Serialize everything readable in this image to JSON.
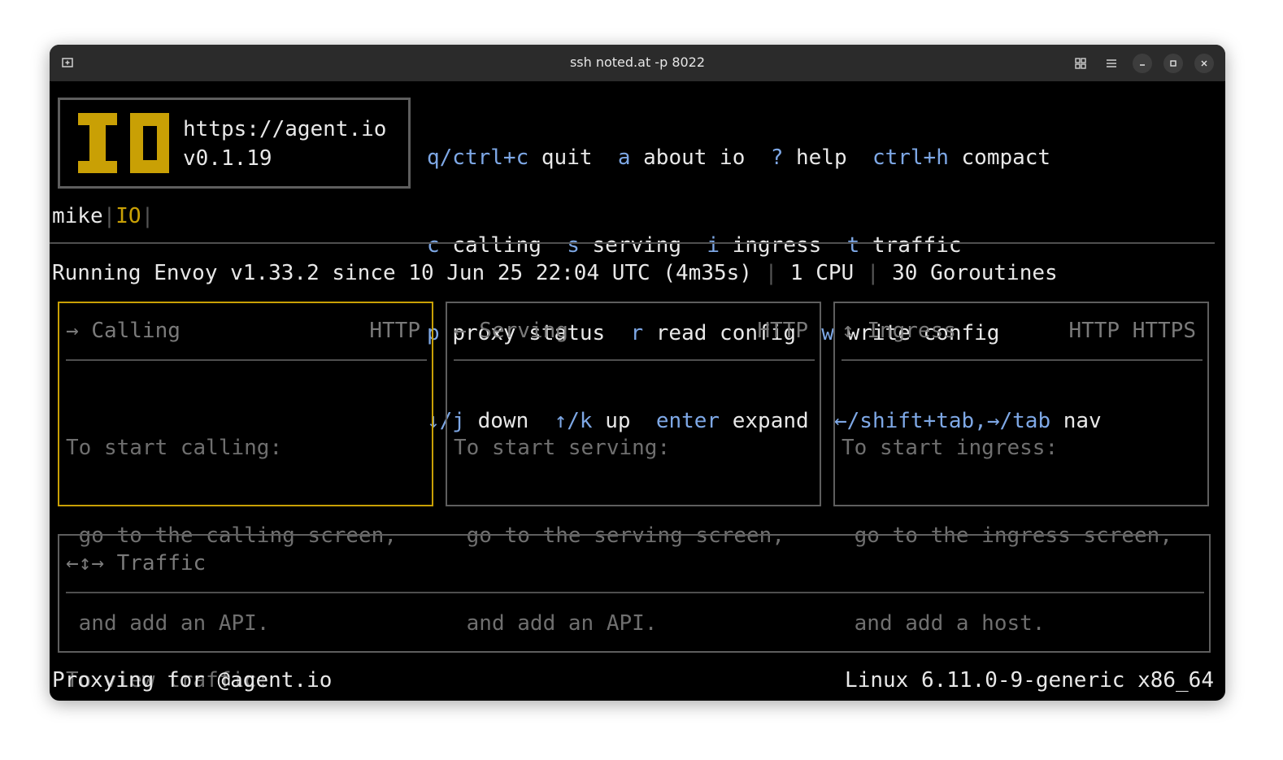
{
  "window": {
    "title": "ssh noted.at -p 8022"
  },
  "logo": {
    "url": "https://agent.io",
    "version": "v0.1.19",
    "mark_color": "#c9a005"
  },
  "help": {
    "rows": [
      [
        {
          "key": "q/ctrl+c",
          "desc": "quit"
        },
        {
          "key": "a",
          "desc": "about io"
        },
        {
          "key": "?",
          "desc": "help"
        },
        {
          "key": "ctrl+h",
          "desc": "compact"
        }
      ],
      [
        {
          "key": "c",
          "desc": "calling"
        },
        {
          "key": "s",
          "desc": "serving"
        },
        {
          "key": "i",
          "desc": "ingress"
        },
        {
          "key": "t",
          "desc": "traffic"
        }
      ],
      [
        {
          "key": "p",
          "desc": "proxy status"
        },
        {
          "key": "r",
          "desc": "read config"
        },
        {
          "key": "w",
          "desc": "write config"
        }
      ],
      [
        {
          "key": "↓/j",
          "desc": "down"
        },
        {
          "key": "↑/k",
          "desc": "up"
        },
        {
          "key": "enter",
          "desc": "expand"
        },
        {
          "key": "←/shift+tab,→/tab",
          "desc": "nav"
        }
      ]
    ],
    "key_color": "#7ea8e6"
  },
  "user": {
    "name": "mike",
    "separator": "|",
    "tag": "IO"
  },
  "status": {
    "running": "Running Envoy v1.33.2 since 10 Jun 25 22:04 UTC (4m35s)",
    "cpu": "1 CPU",
    "goroutines": "30 Goroutines",
    "separator": "|"
  },
  "panels": [
    {
      "icon": "→",
      "title": "Calling",
      "protocols": "HTTP",
      "line1": "To start calling:",
      "line2": " go to the calling screen,",
      "line3": " and add an API.",
      "active": true
    },
    {
      "icon": "←",
      "title": "Serving",
      "protocols": "HTTP",
      "line1": "To start serving:",
      "line2": " go to the serving screen,",
      "line3": " and add an API.",
      "active": false
    },
    {
      "icon": "↕",
      "title": "Ingress",
      "protocols": "HTTP HTTPS",
      "line1": "To start ingress:",
      "line2": " go to the ingress screen,",
      "line3": " and add a host.",
      "active": false
    }
  ],
  "traffic": {
    "icon": "←↕→",
    "title": "Traffic",
    "line1": "To view traffic:"
  },
  "footer": {
    "left": "Proxying for @agent.io",
    "right": "Linux 6.11.0-9-generic x86_64"
  },
  "colors": {
    "accent_yellow": "#c9a005",
    "key_blue": "#7ea8e6",
    "dim_text": "#6f6f6f",
    "border": "#5e5e5e"
  }
}
